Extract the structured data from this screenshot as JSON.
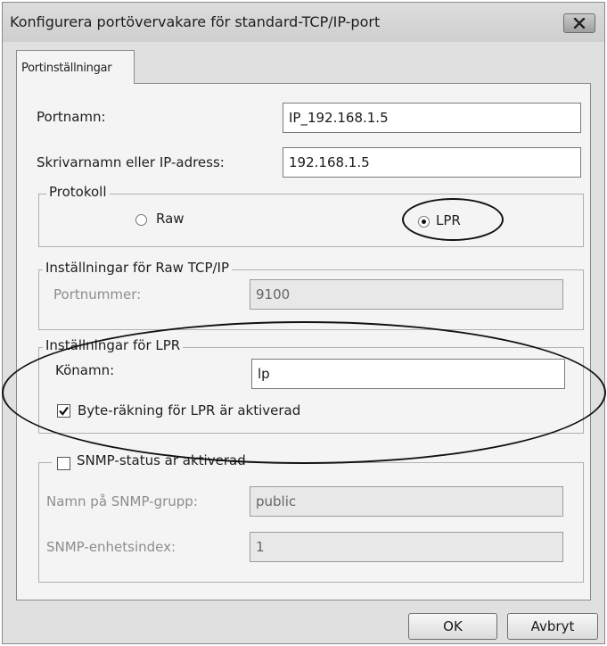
{
  "window": {
    "title": "Konfigurera portövervakare för standard-TCP/IP-port"
  },
  "tabs": [
    {
      "label": "Portinställningar",
      "active": true
    }
  ],
  "port_name": {
    "label": "Portnamn:",
    "value": "IP_192.168.1.5"
  },
  "printer_address": {
    "label": "Skrivarnamn eller IP-adress:",
    "value": "192.168.1.5"
  },
  "protocol": {
    "legend": "Protokoll",
    "options": [
      {
        "label": "Raw",
        "selected": false
      },
      {
        "label": "LPR",
        "selected": true
      }
    ]
  },
  "raw_settings": {
    "legend": "Inställningar för Raw TCP/IP",
    "port_number_label": "Portnummer:",
    "port_number_value": "9100",
    "enabled": false
  },
  "lpr_settings": {
    "legend": "Inställningar för LPR",
    "queue_name_label": "Könamn:",
    "queue_name_value": "lp",
    "byte_counting_label": "Byte-räkning för LPR är aktiverad",
    "byte_counting_checked": true
  },
  "snmp": {
    "legend": "SNMP-status är aktiverad",
    "enabled_checked": false,
    "community_label": "Namn på SNMP-grupp:",
    "community_value": "public",
    "device_index_label": "SNMP-enhetsindex:",
    "device_index_value": "1"
  },
  "buttons": {
    "ok": "OK",
    "cancel": "Avbryt"
  },
  "colors": {
    "annotation_oval": "#111111",
    "window_bg": "#e0e0e0",
    "panel_bg": "#f4f4f4"
  }
}
